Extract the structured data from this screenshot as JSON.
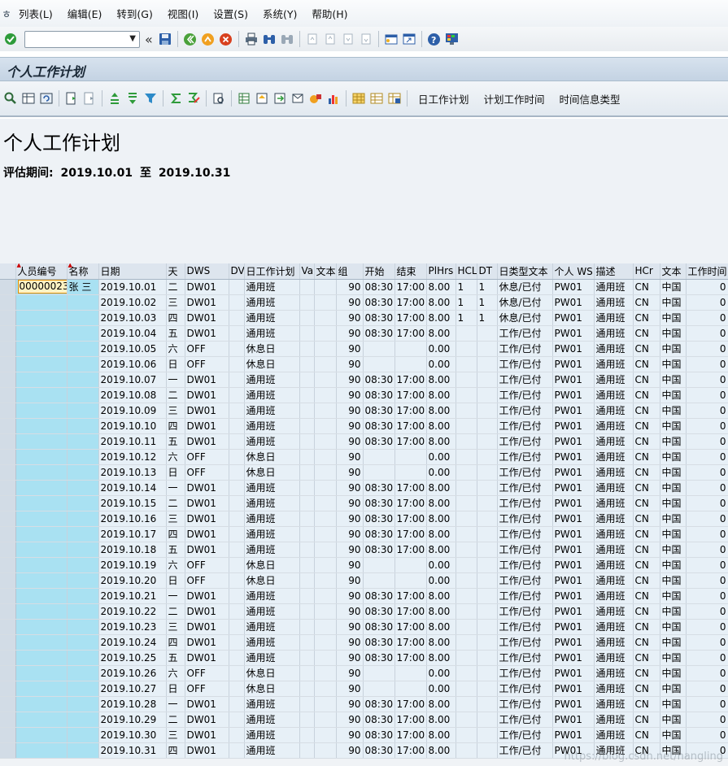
{
  "menubar": {
    "items": [
      "列表(L)",
      "编辑(E)",
      "转到(G)",
      "视图(I)",
      "设置(S)",
      "系统(Y)",
      "帮助(H)"
    ]
  },
  "systoolbar": {
    "command_value": ""
  },
  "titlebar": {
    "title": "个人工作计划"
  },
  "apptoolbar": {
    "buttons": [
      "日工作计划",
      "计划工作时间",
      "时间信息类型"
    ]
  },
  "header": {
    "title": "个人工作计划",
    "period_label": "评估期间:",
    "period_from": "2019.10.01",
    "period_to_word": "至",
    "period_to": "2019.10.31"
  },
  "grid": {
    "columns": [
      "",
      "人员编号",
      "名称",
      "日期",
      "天",
      "DWS",
      "DV",
      "日工作计划",
      "Va",
      "文本",
      "组",
      "开始",
      "结束",
      "PlHrs",
      "HCL",
      "DT",
      "日类型文本",
      "个人 WS",
      "描述",
      "HCr",
      "文本",
      "工作时间"
    ],
    "first_row": {
      "pernr": "00000023",
      "name": "张 三"
    },
    "rows": [
      [
        "2019.10.01",
        "二",
        "DW01",
        "通用班",
        "90",
        "08:30",
        "17:00",
        "8.00",
        "1",
        "1",
        "休息/已付",
        "PW01",
        "通用班",
        "CN",
        "中国",
        "0"
      ],
      [
        "2019.10.02",
        "三",
        "DW01",
        "通用班",
        "90",
        "08:30",
        "17:00",
        "8.00",
        "1",
        "1",
        "休息/已付",
        "PW01",
        "通用班",
        "CN",
        "中国",
        "0"
      ],
      [
        "2019.10.03",
        "四",
        "DW01",
        "通用班",
        "90",
        "08:30",
        "17:00",
        "8.00",
        "1",
        "1",
        "休息/已付",
        "PW01",
        "通用班",
        "CN",
        "中国",
        "0"
      ],
      [
        "2019.10.04",
        "五",
        "DW01",
        "通用班",
        "90",
        "08:30",
        "17:00",
        "8.00",
        "",
        "",
        "工作/已付",
        "PW01",
        "通用班",
        "CN",
        "中国",
        "0"
      ],
      [
        "2019.10.05",
        "六",
        "OFF",
        "休息日",
        "90",
        "",
        "",
        "0.00",
        "",
        "",
        "工作/已付",
        "PW01",
        "通用班",
        "CN",
        "中国",
        "0"
      ],
      [
        "2019.10.06",
        "日",
        "OFF",
        "休息日",
        "90",
        "",
        "",
        "0.00",
        "",
        "",
        "工作/已付",
        "PW01",
        "通用班",
        "CN",
        "中国",
        "0"
      ],
      [
        "2019.10.07",
        "一",
        "DW01",
        "通用班",
        "90",
        "08:30",
        "17:00",
        "8.00",
        "",
        "",
        "工作/已付",
        "PW01",
        "通用班",
        "CN",
        "中国",
        "0"
      ],
      [
        "2019.10.08",
        "二",
        "DW01",
        "通用班",
        "90",
        "08:30",
        "17:00",
        "8.00",
        "",
        "",
        "工作/已付",
        "PW01",
        "通用班",
        "CN",
        "中国",
        "0"
      ],
      [
        "2019.10.09",
        "三",
        "DW01",
        "通用班",
        "90",
        "08:30",
        "17:00",
        "8.00",
        "",
        "",
        "工作/已付",
        "PW01",
        "通用班",
        "CN",
        "中国",
        "0"
      ],
      [
        "2019.10.10",
        "四",
        "DW01",
        "通用班",
        "90",
        "08:30",
        "17:00",
        "8.00",
        "",
        "",
        "工作/已付",
        "PW01",
        "通用班",
        "CN",
        "中国",
        "0"
      ],
      [
        "2019.10.11",
        "五",
        "DW01",
        "通用班",
        "90",
        "08:30",
        "17:00",
        "8.00",
        "",
        "",
        "工作/已付",
        "PW01",
        "通用班",
        "CN",
        "中国",
        "0"
      ],
      [
        "2019.10.12",
        "六",
        "OFF",
        "休息日",
        "90",
        "",
        "",
        "0.00",
        "",
        "",
        "工作/已付",
        "PW01",
        "通用班",
        "CN",
        "中国",
        "0"
      ],
      [
        "2019.10.13",
        "日",
        "OFF",
        "休息日",
        "90",
        "",
        "",
        "0.00",
        "",
        "",
        "工作/已付",
        "PW01",
        "通用班",
        "CN",
        "中国",
        "0"
      ],
      [
        "2019.10.14",
        "一",
        "DW01",
        "通用班",
        "90",
        "08:30",
        "17:00",
        "8.00",
        "",
        "",
        "工作/已付",
        "PW01",
        "通用班",
        "CN",
        "中国",
        "0"
      ],
      [
        "2019.10.15",
        "二",
        "DW01",
        "通用班",
        "90",
        "08:30",
        "17:00",
        "8.00",
        "",
        "",
        "工作/已付",
        "PW01",
        "通用班",
        "CN",
        "中国",
        "0"
      ],
      [
        "2019.10.16",
        "三",
        "DW01",
        "通用班",
        "90",
        "08:30",
        "17:00",
        "8.00",
        "",
        "",
        "工作/已付",
        "PW01",
        "通用班",
        "CN",
        "中国",
        "0"
      ],
      [
        "2019.10.17",
        "四",
        "DW01",
        "通用班",
        "90",
        "08:30",
        "17:00",
        "8.00",
        "",
        "",
        "工作/已付",
        "PW01",
        "通用班",
        "CN",
        "中国",
        "0"
      ],
      [
        "2019.10.18",
        "五",
        "DW01",
        "通用班",
        "90",
        "08:30",
        "17:00",
        "8.00",
        "",
        "",
        "工作/已付",
        "PW01",
        "通用班",
        "CN",
        "中国",
        "0"
      ],
      [
        "2019.10.19",
        "六",
        "OFF",
        "休息日",
        "90",
        "",
        "",
        "0.00",
        "",
        "",
        "工作/已付",
        "PW01",
        "通用班",
        "CN",
        "中国",
        "0"
      ],
      [
        "2019.10.20",
        "日",
        "OFF",
        "休息日",
        "90",
        "",
        "",
        "0.00",
        "",
        "",
        "工作/已付",
        "PW01",
        "通用班",
        "CN",
        "中国",
        "0"
      ],
      [
        "2019.10.21",
        "一",
        "DW01",
        "通用班",
        "90",
        "08:30",
        "17:00",
        "8.00",
        "",
        "",
        "工作/已付",
        "PW01",
        "通用班",
        "CN",
        "中国",
        "0"
      ],
      [
        "2019.10.22",
        "二",
        "DW01",
        "通用班",
        "90",
        "08:30",
        "17:00",
        "8.00",
        "",
        "",
        "工作/已付",
        "PW01",
        "通用班",
        "CN",
        "中国",
        "0"
      ],
      [
        "2019.10.23",
        "三",
        "DW01",
        "通用班",
        "90",
        "08:30",
        "17:00",
        "8.00",
        "",
        "",
        "工作/已付",
        "PW01",
        "通用班",
        "CN",
        "中国",
        "0"
      ],
      [
        "2019.10.24",
        "四",
        "DW01",
        "通用班",
        "90",
        "08:30",
        "17:00",
        "8.00",
        "",
        "",
        "工作/已付",
        "PW01",
        "通用班",
        "CN",
        "中国",
        "0"
      ],
      [
        "2019.10.25",
        "五",
        "DW01",
        "通用班",
        "90",
        "08:30",
        "17:00",
        "8.00",
        "",
        "",
        "工作/已付",
        "PW01",
        "通用班",
        "CN",
        "中国",
        "0"
      ],
      [
        "2019.10.26",
        "六",
        "OFF",
        "休息日",
        "90",
        "",
        "",
        "0.00",
        "",
        "",
        "工作/已付",
        "PW01",
        "通用班",
        "CN",
        "中国",
        "0"
      ],
      [
        "2019.10.27",
        "日",
        "OFF",
        "休息日",
        "90",
        "",
        "",
        "0.00",
        "",
        "",
        "工作/已付",
        "PW01",
        "通用班",
        "CN",
        "中国",
        "0"
      ],
      [
        "2019.10.28",
        "一",
        "DW01",
        "通用班",
        "90",
        "08:30",
        "17:00",
        "8.00",
        "",
        "",
        "工作/已付",
        "PW01",
        "通用班",
        "CN",
        "中国",
        "0"
      ],
      [
        "2019.10.29",
        "二",
        "DW01",
        "通用班",
        "90",
        "08:30",
        "17:00",
        "8.00",
        "",
        "",
        "工作/已付",
        "PW01",
        "通用班",
        "CN",
        "中国",
        "0"
      ],
      [
        "2019.10.30",
        "三",
        "DW01",
        "通用班",
        "90",
        "08:30",
        "17:00",
        "8.00",
        "",
        "",
        "工作/已付",
        "PW01",
        "通用班",
        "CN",
        "中国",
        "0"
      ],
      [
        "2019.10.31",
        "四",
        "DW01",
        "通用班",
        "90",
        "08:30",
        "17:00",
        "8.00",
        "",
        "",
        "工作/已付",
        "PW01",
        "通用班",
        "CN",
        "中国",
        "0"
      ]
    ]
  },
  "watermark": "https://blog.csdn.net/hangling"
}
